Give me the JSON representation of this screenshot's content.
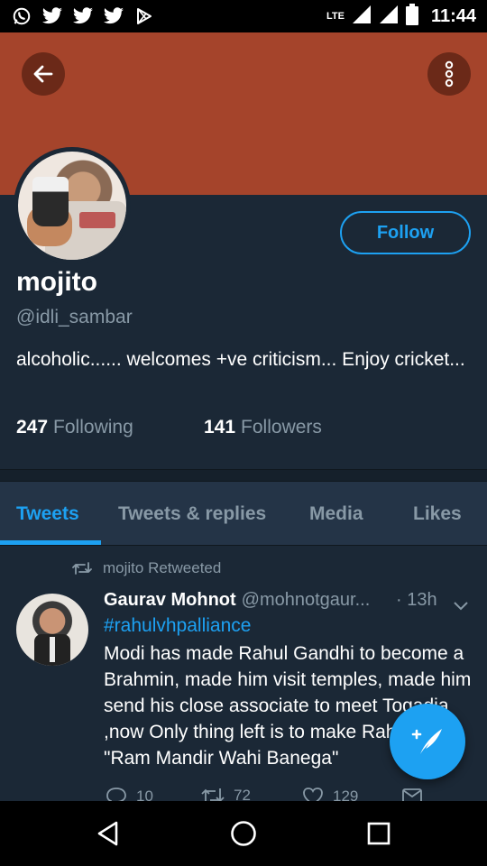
{
  "status_bar": {
    "time": "11:44",
    "network": "LTE",
    "notification_icons": [
      "whatsapp-icon",
      "twitter-icon",
      "twitter-icon",
      "twitter-icon",
      "play-store-icon"
    ]
  },
  "profile": {
    "name": "mojito",
    "handle": "@idli_sambar",
    "bio": "alcoholic...... welcomes +ve criticism... Enjoy cricket...",
    "following_count": "247",
    "following_label": "Following",
    "followers_count": "141",
    "followers_label": "Followers",
    "follow_label": "Follow",
    "banner_color": "#a5442b"
  },
  "tabs": [
    {
      "label": "Tweets",
      "active": true
    },
    {
      "label": "Tweets & replies",
      "active": false
    },
    {
      "label": "Media",
      "active": false
    },
    {
      "label": "Likes",
      "active": false
    }
  ],
  "tweet": {
    "retweet_text": "mojito Retweeted",
    "author_name": "Gaurav Mohnot",
    "author_handle": "@mohnotgaur...",
    "time": "· 13h",
    "hashtag": "#rahulvhpalliance",
    "text": "Modi has made Rahul Gandhi to become a Brahmin, made him visit temples, made him send his close associate to meet Togadia ,now Only thing left is to make Rahul say  \"Ram Mandir Wahi Banega\"",
    "reply_count": "10",
    "retweet_count": "72",
    "like_count": "129"
  },
  "colors": {
    "accent": "#1da1f2",
    "background": "#1b2836",
    "secondary_text": "#8899a6"
  }
}
